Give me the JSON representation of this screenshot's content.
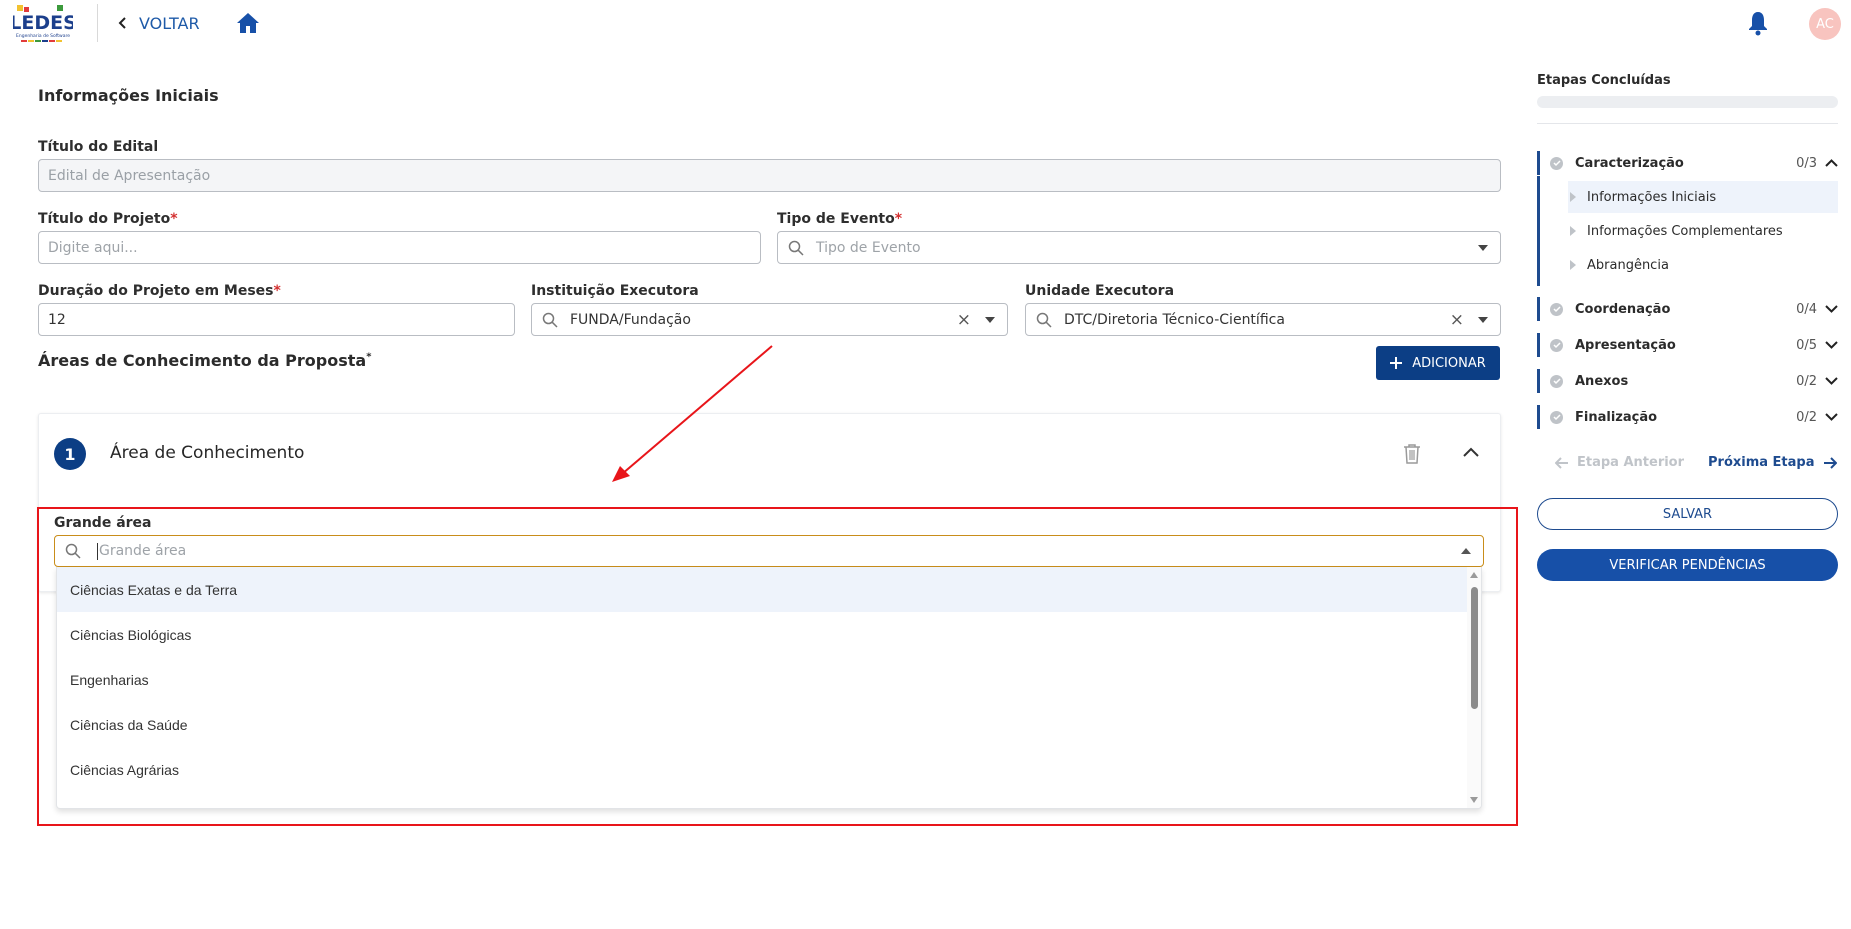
{
  "header": {
    "logo_text": "LEDES",
    "logo_subtitle": "Engenharia de Software",
    "back_label": "VOLTAR",
    "avatar_initials": "AC"
  },
  "form": {
    "section_title": "Informações Iniciais",
    "titulo_edital": {
      "label": "Título do Edital",
      "placeholder": "Edital de Apresentação"
    },
    "titulo_projeto": {
      "label": "Título do Projeto",
      "required_mark": "*",
      "placeholder": "Digite aqui..."
    },
    "tipo_evento": {
      "label": "Tipo de Evento",
      "required_mark": "*",
      "placeholder": "Tipo de Evento"
    },
    "duracao": {
      "label": "Duração do Projeto em Meses",
      "required_mark": "*",
      "value": "12"
    },
    "instituicao": {
      "label": "Instituição Executora",
      "value": "FUNDA/Fundação",
      "clear": "×"
    },
    "unidade": {
      "label": "Unidade Executora",
      "value": "DTC/Diretoria Técnico-Científica",
      "clear": "×"
    },
    "areas_title": "Áreas de Conhecimento da Proposta",
    "areas_required_mark": "*",
    "add_button": "ADICIONAR"
  },
  "area_card": {
    "number": "1",
    "title": "Área de Conhecimento",
    "grande_area_label": "Grande área",
    "grande_area_placeholder": "Grande área",
    "options": [
      "Ciências Exatas e da Terra",
      "Ciências Biológicas",
      "Engenharias",
      "Ciências da Saúde",
      "Ciências Agrárias"
    ],
    "active_option_index": 0
  },
  "sidebar": {
    "title": "Etapas Concluídas",
    "progress_fraction": 0,
    "steps": [
      {
        "name": "Caracterização",
        "count": "0/3",
        "expanded": true
      },
      {
        "name": "Coordenação",
        "count": "0/4",
        "expanded": false
      },
      {
        "name": "Apresentação",
        "count": "0/5",
        "expanded": false
      },
      {
        "name": "Anexos",
        "count": "0/2",
        "expanded": false
      },
      {
        "name": "Finalização",
        "count": "0/2",
        "expanded": false
      }
    ],
    "substeps": [
      "Informações Iniciais",
      "Informações Complementares",
      "Abrangência"
    ],
    "prev_label": "Etapa Anterior",
    "next_label": "Próxima Etapa",
    "save_label": "SALVAR",
    "verify_label": "VERIFICAR PENDÊNCIAS"
  },
  "colors": {
    "primary": "#0c3e85",
    "accent_link": "#1e5aa8",
    "highlight_box": "#e8151a",
    "focus_border": "#c98d1a"
  }
}
